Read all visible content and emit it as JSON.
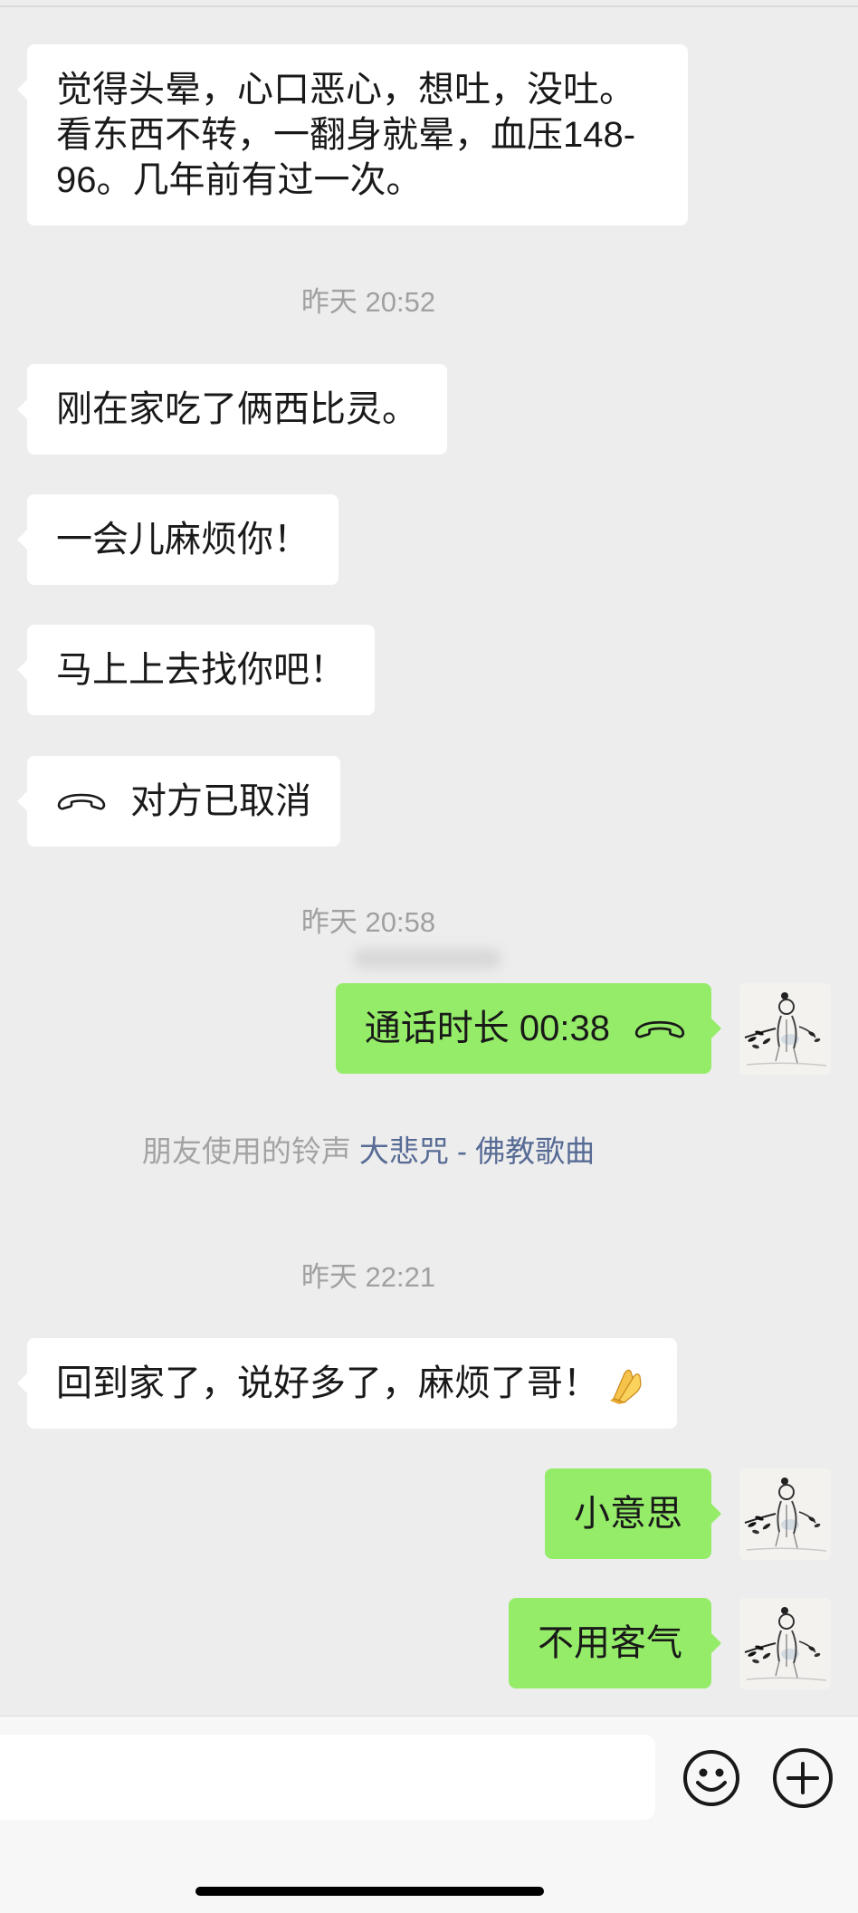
{
  "colors": {
    "chat_background": "#ededed",
    "incoming_bubble": "#ffffff",
    "outgoing_bubble": "#95ec69",
    "text": "#191919",
    "timestamp": "#a0a0a0",
    "link": "#576b95",
    "input_bar": "#f7f7f7"
  },
  "chat": {
    "msg_1": "觉得头晕，心口恶心，想吐，没吐。看东西不转，一翻身就晕，血压148-96。几年前有过一次。",
    "time_1": "昨天 20:52",
    "msg_2": "刚在家吃了俩西比灵。",
    "msg_3": "一会儿麻烦你！",
    "msg_4": "马上上去找你吧！",
    "call_1": {
      "icon": "phone-hangup-icon",
      "text": "对方已取消"
    },
    "time_2": "昨天 20:58",
    "call_2": {
      "text": "通话时长 00:38",
      "icon": "phone-hangup-icon"
    },
    "ringtone": {
      "prefix": "朋友使用的铃声",
      "song": "大悲咒 - 佛教歌曲"
    },
    "time_3": "昨天 22:21",
    "msg_5": {
      "text": "回到家了，说好多了，麻烦了哥！",
      "emoji": "folded-hands-emoji-icon"
    },
    "msg_6": "小意思",
    "msg_7": "不用客气",
    "avatar_icon": "ink-sketch-avatar-icon"
  },
  "input_bar": {
    "value": "",
    "emoji_button_icon": "smiley-icon",
    "more_button_icon": "plus-circle-icon"
  }
}
